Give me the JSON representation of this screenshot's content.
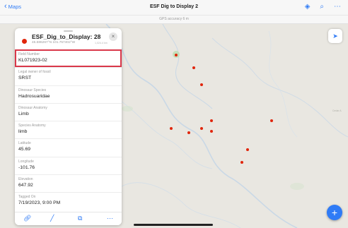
{
  "nav": {
    "back_label": "Maps",
    "title": "ESF Dig to Display 2",
    "gps_accuracy": "GPS accuracy 6 m",
    "layers_icon": "layers-icon",
    "search_icon": "search-icon",
    "more_icon": "more-icon"
  },
  "popup": {
    "title": "ESF_Dig_to_Display: 28",
    "coords": "45.686267°N 101.757402°W",
    "distance": "1,024.4 km",
    "close_icon": "close-icon",
    "fields": [
      {
        "label": "Field Number",
        "value": "KL071923-02"
      },
      {
        "label": "Legal owner of fossil",
        "value": "SRST"
      },
      {
        "label": "Dinosaur Species",
        "value": "Hadrosuaridae"
      },
      {
        "label": "Dinosaur Anatomy",
        "value": "Limb"
      },
      {
        "label": "Species Anatomy",
        "value": "limb"
      },
      {
        "label": "Latitude",
        "value": "45.69"
      },
      {
        "label": "Longitude",
        "value": "-101.76"
      },
      {
        "label": "Elevation",
        "value": "647.92"
      },
      {
        "label": "Tagged On",
        "value": "7/19/2023, 9:00 PM"
      }
    ],
    "toolbar_icons": [
      "link-icon",
      "edit-icon",
      "duplicate-icon",
      "more-icon"
    ]
  },
  "map": {
    "label_fragment": "Cedar A",
    "accent_color": "#2f7bf6",
    "point_color": "#e0260c",
    "highlight_color": "#d9384a"
  }
}
